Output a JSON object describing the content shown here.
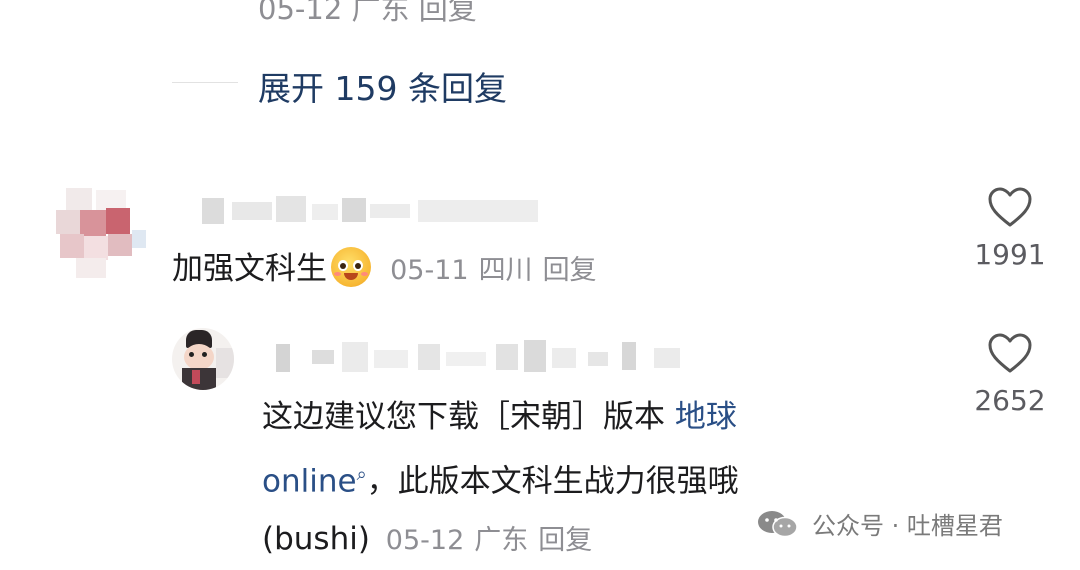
{
  "top_row": {
    "date": "05-12",
    "location": "广东",
    "reply": "回复"
  },
  "expand": {
    "label": "展开 159 条回复"
  },
  "comments": [
    {
      "text": "加强文科生",
      "emoji": "smiling-face-emoji",
      "date": "05-11",
      "location": "四川",
      "reply": "回复",
      "likes": "1991"
    },
    {
      "text_line1": "这边建议您下载［宋朝］版本",
      "link_text": "地球",
      "link_text2": "online",
      "text_line2": "，此版本文科生战力很强哦",
      "text_line3": "(bushi)",
      "date": "05-12",
      "location": "广东",
      "reply": "回复",
      "likes": "2652"
    }
  ],
  "watermark": {
    "label": "公众号 · 吐槽星君"
  },
  "colors": {
    "link": "#2a4f86",
    "expand": "#1f3b63",
    "meta": "#8e8e93"
  }
}
